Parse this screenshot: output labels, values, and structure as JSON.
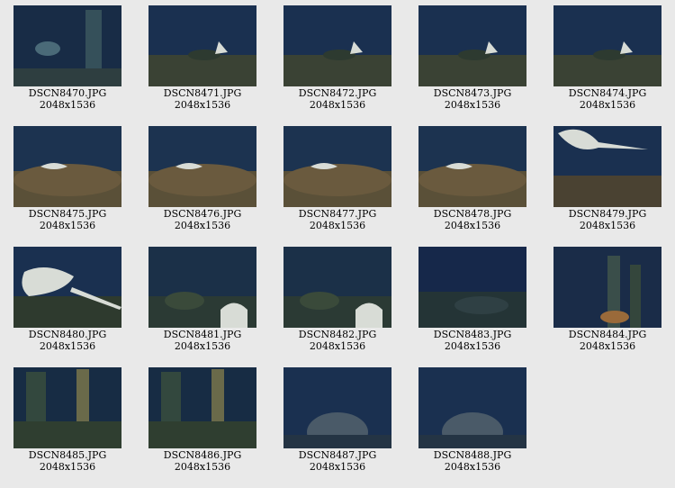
{
  "thumbnails": [
    {
      "filename": "DSCN8470.JPG",
      "dimensions": "2048x1536",
      "scene": "vent-chimney"
    },
    {
      "filename": "DSCN8471.JPG",
      "dimensions": "2048x1536",
      "scene": "ray-distant"
    },
    {
      "filename": "DSCN8472.JPG",
      "dimensions": "2048x1536",
      "scene": "ray-distant"
    },
    {
      "filename": "DSCN8473.JPG",
      "dimensions": "2048x1536",
      "scene": "ray-distant"
    },
    {
      "filename": "DSCN8474.JPG",
      "dimensions": "2048x1536",
      "scene": "ray-distant"
    },
    {
      "filename": "DSCN8475.JPG",
      "dimensions": "2048x1536",
      "scene": "ray-sediment"
    },
    {
      "filename": "DSCN8476.JPG",
      "dimensions": "2048x1536",
      "scene": "ray-sediment"
    },
    {
      "filename": "DSCN8477.JPG",
      "dimensions": "2048x1536",
      "scene": "ray-sediment"
    },
    {
      "filename": "DSCN8478.JPG",
      "dimensions": "2048x1536",
      "scene": "ray-sediment"
    },
    {
      "filename": "DSCN8479.JPG",
      "dimensions": "2048x1536",
      "scene": "ray-large"
    },
    {
      "filename": "DSCN8480.JPG",
      "dimensions": "2048x1536",
      "scene": "ray-closeup"
    },
    {
      "filename": "DSCN8481.JPG",
      "dimensions": "2048x1536",
      "scene": "ray-rocks"
    },
    {
      "filename": "DSCN8482.JPG",
      "dimensions": "2048x1536",
      "scene": "ray-rocks"
    },
    {
      "filename": "DSCN8483.JPG",
      "dimensions": "2048x1536",
      "scene": "dark-floor"
    },
    {
      "filename": "DSCN8484.JPG",
      "dimensions": "2048x1536",
      "scene": "chimney-orange"
    },
    {
      "filename": "DSCN8485.JPG",
      "dimensions": "2048x1536",
      "scene": "chimneys"
    },
    {
      "filename": "DSCN8486.JPG",
      "dimensions": "2048x1536",
      "scene": "chimneys"
    },
    {
      "filename": "DSCN8487.JPG",
      "dimensions": "2048x1536",
      "scene": "mound"
    },
    {
      "filename": "DSCN8488.JPG",
      "dimensions": "2048x1536",
      "scene": "mound"
    }
  ],
  "colors": {
    "background": "#e9e9e9",
    "water": "#1a3050",
    "seafloor": "#3a4234",
    "sediment": "#6a5a3e",
    "ray": "#d8dcd6"
  }
}
